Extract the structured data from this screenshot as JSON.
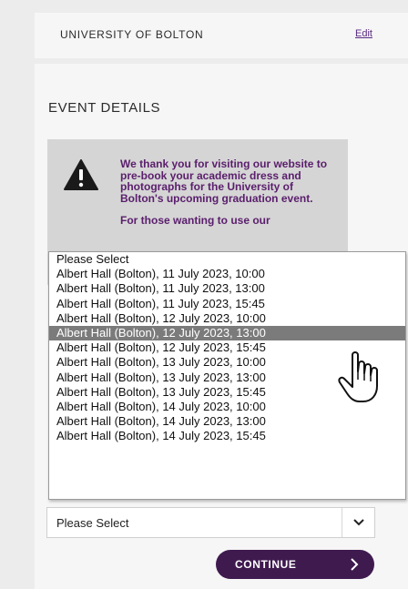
{
  "university": {
    "name": "UNIVERSITY OF BOLTON",
    "edit_label": "Edit"
  },
  "event": {
    "title": "EVENT DETAILS",
    "notice": {
      "icon": "warning-icon",
      "paragraph1": "We thank you for visiting our website to pre-book your academic dress and photographs for the University of Bolton's upcoming graduation event.",
      "paragraph2": "For those wanting to use our"
    }
  },
  "dropdown": {
    "selected_index": 5,
    "options": [
      "Please Select",
      "Albert Hall (Bolton), 11 July 2023, 10:00",
      "Albert Hall (Bolton), 11 July 2023, 13:00",
      "Albert Hall (Bolton), 11 July 2023, 15:45",
      "Albert Hall (Bolton), 12 July 2023, 10:00",
      "Albert Hall (Bolton), 12 July 2023, 13:00",
      "Albert Hall (Bolton), 12 July 2023, 15:45",
      "Albert Hall (Bolton), 13 July 2023, 10:00",
      "Albert Hall (Bolton), 13 July 2023, 13:00",
      "Albert Hall (Bolton), 13 July 2023, 15:45",
      "Albert Hall (Bolton), 14 July 2023, 10:00",
      "Albert Hall (Bolton), 14 July 2023, 13:00",
      "Albert Hall (Bolton), 14 July 2023, 15:45"
    ]
  },
  "select": {
    "value": "Please Select",
    "icon": "chevron-down-icon"
  },
  "continue_button": {
    "label": "CONTINUE",
    "icon": "chevron-right-icon"
  },
  "cursor": {
    "icon": "hand-pointer-icon"
  },
  "colors": {
    "brand": "#3f1a4f",
    "notice_text": "#5a1e6c",
    "highlight": "#7b7b7b"
  }
}
